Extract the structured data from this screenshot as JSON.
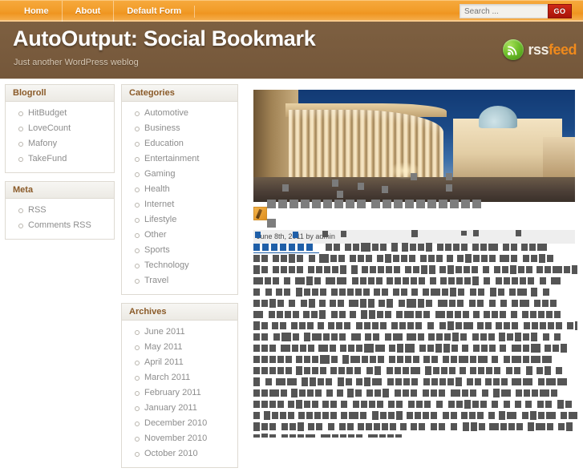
{
  "nav": {
    "items": [
      {
        "label": "Home"
      },
      {
        "label": "About"
      },
      {
        "label": "Default Form"
      }
    ]
  },
  "search": {
    "placeholder": "Search ...",
    "value": "",
    "button_label": "GO"
  },
  "header": {
    "title": "AutoOutput: Social Bookmark",
    "description": "Just another WordPress weblog",
    "rss_logo_primary": "rss",
    "rss_logo_secondary": "feed",
    "bg_color": "#7a5c3e",
    "accent_color": "#f2991f"
  },
  "sidebar": {
    "widgets": [
      {
        "title": "Blogroll",
        "items": [
          "HitBudget",
          "LoveCount",
          "Mafony",
          "TakeFund"
        ]
      },
      {
        "title": "Meta",
        "items": [
          "RSS",
          "Comments RSS"
        ]
      },
      {
        "title": "Categories",
        "items": [
          "Automotive",
          "Business",
          "Education",
          "Entertainment",
          "Gaming",
          "Health",
          "Internet",
          "Lifestyle",
          "Other",
          "Sports",
          "Technology",
          "Travel"
        ]
      },
      {
        "title": "Archives",
        "items": [
          "June 2011",
          "May 2011",
          "April 2011",
          "March 2011",
          "February 2011",
          "January 2011",
          "December 2010",
          "November 2010",
          "October 2010"
        ]
      }
    ]
  },
  "post": {
    "image_alt": "saint-peters-square-colonnade-at-dusk",
    "meta_text": "June 8th, 2011 by admin",
    "title_redacted": true,
    "body_redacted": true,
    "redaction_color": "#555555",
    "link_color": "#1f5fa8",
    "meta_bg_color": "#eeeeee",
    "title_blocks_row1": [
      14,
      0,
      0,
      0,
      0,
      0,
      13,
      0,
      0,
      0,
      0,
      0,
      0,
      0,
      0,
      0,
      0,
      0,
      0,
      0,
      0,
      0,
      0,
      0,
      0,
      0,
      0,
      0,
      13,
      0,
      0,
      0,
      0,
      0,
      0,
      0,
      13,
      13
    ],
    "title_blocks_row2_count": 19,
    "title_blocks_row3_count": 1
  }
}
